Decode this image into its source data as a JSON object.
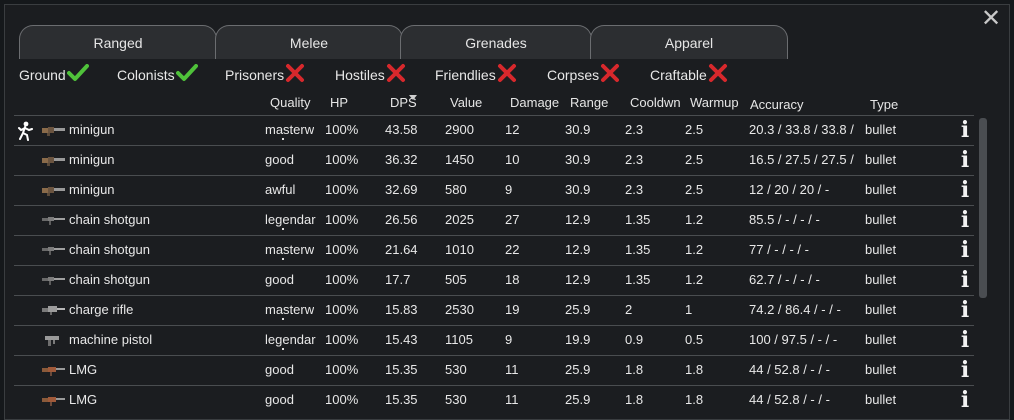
{
  "tabs": [
    {
      "label": "Ranged"
    },
    {
      "label": "Melee"
    },
    {
      "label": "Grenades"
    },
    {
      "label": "Apparel"
    }
  ],
  "close_label": "✕",
  "filters": [
    {
      "label": "Ground",
      "state": "on"
    },
    {
      "label": "Colonists",
      "state": "on"
    },
    {
      "label": "Prisoners",
      "state": "off"
    },
    {
      "label": "Hostiles",
      "state": "off"
    },
    {
      "label": "Friendlies",
      "state": "off"
    },
    {
      "label": "Corpses",
      "state": "off"
    },
    {
      "label": "Craftable",
      "state": "off"
    }
  ],
  "columns": {
    "quality": "Quality",
    "hp": "HP",
    "dps": "DPS",
    "value": "Value",
    "damage": "Damage",
    "range": "Range",
    "cooldown": "Cooldwn",
    "warmup": "Warmup",
    "accuracy": "Accuracy",
    "type": "Type"
  },
  "info_glyph": "i",
  "rows": [
    {
      "name": "minigun",
      "quality": "masterw",
      "hp": "100%",
      "dps": "43.58",
      "value": "2900",
      "damage": "12",
      "range": "30.9",
      "cooldown": "2.3",
      "warmup": "2.5",
      "accuracy": "20.3 / 33.8 / 33.8 /",
      "type": "bullet",
      "icon": "minigun-icon",
      "equipped": true,
      "truncated": true
    },
    {
      "name": "minigun",
      "quality": "good",
      "hp": "100%",
      "dps": "36.32",
      "value": "1450",
      "damage": "10",
      "range": "30.9",
      "cooldown": "2.3",
      "warmup": "2.5",
      "accuracy": "16.5 / 27.5 / 27.5 /",
      "type": "bullet",
      "icon": "minigun-icon",
      "equipped": false,
      "truncated": false
    },
    {
      "name": "minigun",
      "quality": "awful",
      "hp": "100%",
      "dps": "32.69",
      "value": "580",
      "damage": "9",
      "range": "30.9",
      "cooldown": "2.3",
      "warmup": "2.5",
      "accuracy": "12 / 20 / 20 / -",
      "type": "bullet",
      "icon": "minigun-icon",
      "equipped": false,
      "truncated": false
    },
    {
      "name": "chain shotgun",
      "quality": "legendar",
      "hp": "100%",
      "dps": "26.56",
      "value": "2025",
      "damage": "27",
      "range": "12.9",
      "cooldown": "1.35",
      "warmup": "1.2",
      "accuracy": "85.5 / - / - / -",
      "type": "bullet",
      "icon": "shotgun-icon",
      "equipped": false,
      "truncated": true
    },
    {
      "name": "chain shotgun",
      "quality": "masterw",
      "hp": "100%",
      "dps": "21.64",
      "value": "1010",
      "damage": "22",
      "range": "12.9",
      "cooldown": "1.35",
      "warmup": "1.2",
      "accuracy": "77 / - / - / -",
      "type": "bullet",
      "icon": "shotgun-icon",
      "equipped": false,
      "truncated": true
    },
    {
      "name": "chain shotgun",
      "quality": "good",
      "hp": "100%",
      "dps": "17.7",
      "value": "505",
      "damage": "18",
      "range": "12.9",
      "cooldown": "1.35",
      "warmup": "1.2",
      "accuracy": "62.7 / - / - / -",
      "type": "bullet",
      "icon": "shotgun-icon",
      "equipped": false,
      "truncated": false
    },
    {
      "name": "charge rifle",
      "quality": "masterw",
      "hp": "100%",
      "dps": "15.83",
      "value": "2530",
      "damage": "19",
      "range": "25.9",
      "cooldown": "2",
      "warmup": "1",
      "accuracy": "74.2 / 86.4 / - / -",
      "type": "bullet",
      "icon": "charge-rifle-icon",
      "equipped": false,
      "truncated": true
    },
    {
      "name": "machine pistol",
      "quality": "legendar",
      "hp": "100%",
      "dps": "15.43",
      "value": "1105",
      "damage": "9",
      "range": "19.9",
      "cooldown": "0.9",
      "warmup": "0.5",
      "accuracy": "100 / 97.5 / - / -",
      "type": "bullet",
      "icon": "machine-pistol-icon",
      "equipped": false,
      "truncated": true
    },
    {
      "name": "LMG",
      "quality": "good",
      "hp": "100%",
      "dps": "15.35",
      "value": "530",
      "damage": "11",
      "range": "25.9",
      "cooldown": "1.8",
      "warmup": "1.8",
      "accuracy": "44 / 52.8 / - / -",
      "type": "bullet",
      "icon": "lmg-icon",
      "equipped": false,
      "truncated": false
    },
    {
      "name": "LMG",
      "quality": "good",
      "hp": "100%",
      "dps": "15.35",
      "value": "530",
      "damage": "11",
      "range": "25.9",
      "cooldown": "1.8",
      "warmup": "1.8",
      "accuracy": "44 / 52.8 / - / -",
      "type": "bullet",
      "icon": "lmg-icon",
      "equipped": false,
      "truncated": false
    }
  ],
  "colors": {
    "check": "#4fc23a",
    "cross": "#d8282c",
    "row_border": "#4a4d50"
  }
}
